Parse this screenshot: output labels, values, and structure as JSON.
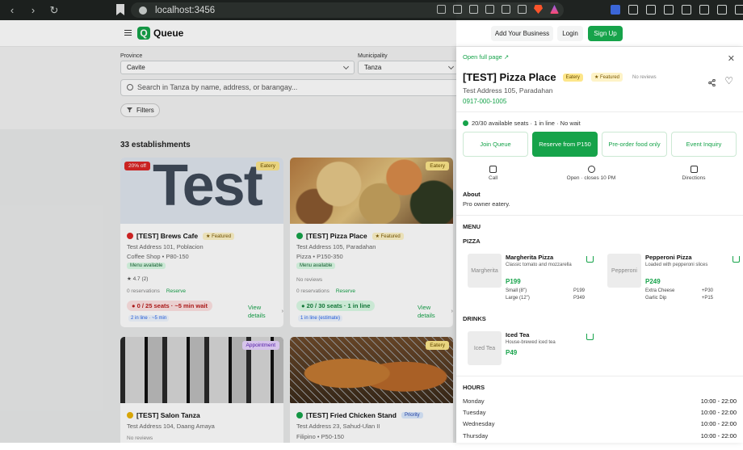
{
  "browser": {
    "url": "localhost:3456"
  },
  "header": {
    "brand": "Queue",
    "add_business": "Add Your Business",
    "login": "Login",
    "signup": "Sign Up"
  },
  "filters": {
    "province_label": "Province",
    "province_value": "Cavite",
    "municipality_label": "Municipality",
    "municipality_value": "Tanza",
    "search_placeholder": "Search in Tanza by name, address, or barangay...",
    "filters_button": "Filters"
  },
  "results": {
    "count": "33 establishments"
  },
  "cards": [
    {
      "name": "[TEST] Brews Cafe",
      "category_tag": "Eatery",
      "discount": "20% off",
      "image_text": "Test",
      "featured": "Featured",
      "address": "Test Address 101, Poblacion",
      "meta": "Coffee Shop • P80-150",
      "menu": "Menu available",
      "rating": "★ 4.7 (2)",
      "reservations": "0 reservations",
      "reserve": "Reserve",
      "seats": "0 / 25 seats · ~5 min wait",
      "line": "2 in line · ~5 min",
      "view": "View details",
      "status_color": "#dc2626"
    },
    {
      "name": "[TEST] Pizza Place",
      "category_tag": "Eatery",
      "featured": "Featured",
      "address": "Test Address 105, Paradahan",
      "meta": "Pizza • P150-350",
      "menu": "Menu available",
      "reviews": "No reviews",
      "reservations": "0 reservations",
      "reserve": "Reserve",
      "seats": "20 / 30 seats · 1 in line",
      "line": "1 in line (estimate)",
      "view": "View details",
      "status_color": "#16a34a"
    },
    {
      "name": "[TEST] Salon Tanza",
      "category_tag": "Appointment",
      "address": "Test Address 104, Daang Amaya",
      "reviews": "No reviews",
      "status_color": "#eab308"
    },
    {
      "name": "[TEST] Fried Chicken Stand",
      "category_tag": "Eatery",
      "priority": "Priority",
      "address": "Test Address 23, Sahud-Ulan II",
      "meta": "Filipino • P50-150",
      "status_color": "#16a34a"
    }
  ],
  "detail": {
    "open_full": "Open full page",
    "title": "[TEST] Pizza Place",
    "chip_category": "Eatery",
    "chip_featured": "Featured",
    "reviews": "No reviews",
    "address": "Test Address 105, Paradahan",
    "phone": "0917-000-1005",
    "availability": "20/30 available seats · 1 in line · No wait",
    "actions": {
      "join": "Join Queue",
      "reserve": "Reserve from P150",
      "preorder": "Pre-order food only",
      "inquiry": "Event Inquiry"
    },
    "quick": {
      "call": "Call",
      "hours": "Open · closes 10 PM",
      "directions": "Directions"
    },
    "about_heading": "About",
    "about_text": "Pro owner eatery.",
    "menu_heading": "MENU",
    "pizza_heading": "PIZZA",
    "drinks_heading": "DRINKS",
    "menu_items": [
      {
        "thumb": "Margherita",
        "name": "Margherita Pizza",
        "desc": "Classic tomato and mozzarella",
        "price": "P199",
        "sizes": [
          {
            "label": "Small (8\")",
            "price": "P199"
          },
          {
            "label": "Large (12\")",
            "price": "P349"
          }
        ]
      },
      {
        "thumb": "Pepperoni",
        "name": "Pepperoni Pizza",
        "desc": "Loaded with pepperoni slices",
        "price": "P249",
        "addons": [
          {
            "label": "Extra Cheese",
            "price": "+P30"
          },
          {
            "label": "Garlic Dip",
            "price": "+P15"
          }
        ]
      },
      {
        "thumb": "Iced Tea",
        "name": "Iced Tea",
        "desc": "House-brewed iced tea",
        "price": "P49"
      }
    ],
    "hours_heading": "HOURS",
    "hours": [
      {
        "day": "Monday",
        "time": "10:00 - 22:00"
      },
      {
        "day": "Tuesday",
        "time": "10:00 - 22:00"
      },
      {
        "day": "Wednesday",
        "time": "10:00 - 22:00"
      },
      {
        "day": "Thursday",
        "time": "10:00 - 22:00"
      }
    ]
  },
  "colors": {
    "accent": "#16a34a",
    "danger": "#dc2626"
  }
}
